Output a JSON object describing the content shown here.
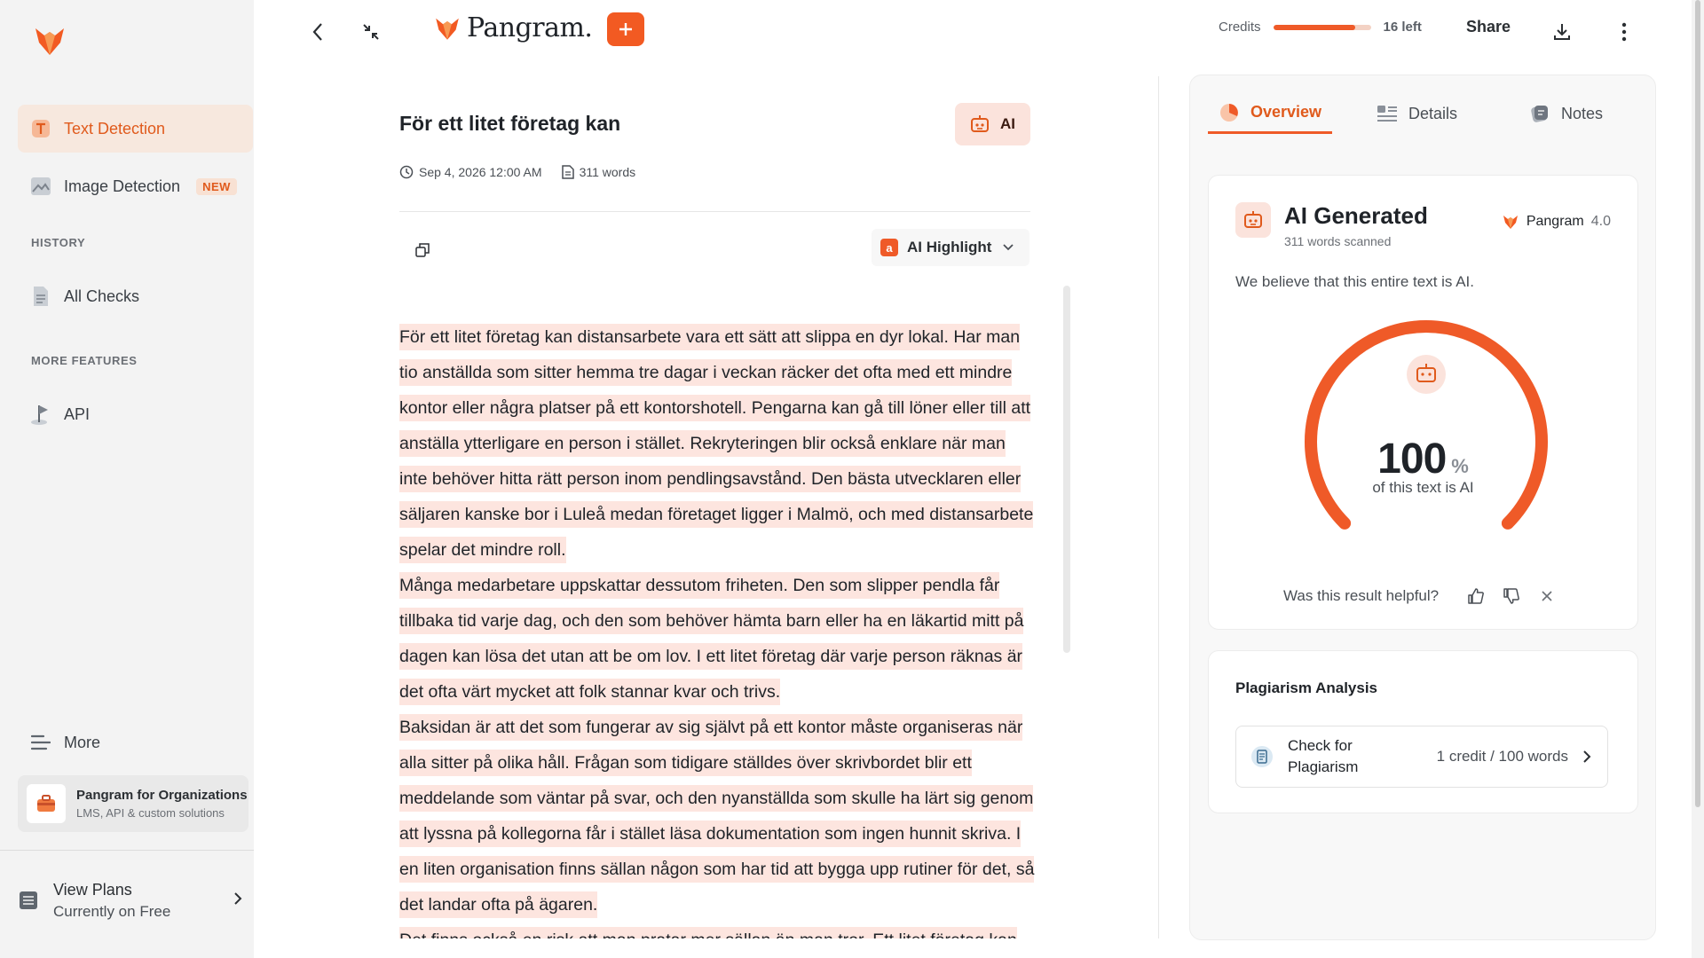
{
  "sidebar": {
    "nav": [
      {
        "label": "Text Detection",
        "icon": "text-icon"
      },
      {
        "label": "Image Detection",
        "icon": "image-icon",
        "badge": "NEW"
      }
    ],
    "history_label": "HISTORY",
    "all_checks": "All Checks",
    "more_features_label": "MORE FEATURES",
    "api": "API",
    "more": "More",
    "org": {
      "title": "Pangram for Organizations",
      "subtitle": "LMS, API & custom solutions"
    },
    "plans": {
      "title": "View Plans",
      "subtitle": "Currently on Free"
    }
  },
  "topbar": {
    "brand": "Pangram.",
    "credits_label": "Credits",
    "credits_left": "16 left",
    "credits_fraction": 0.84,
    "share": "Share"
  },
  "document": {
    "title": "För ett litet företag kan",
    "verdict_badge": "AI",
    "date": "Sep 4, 2026 12:00 AM",
    "words": "311 words",
    "highlight_mode": "AI Highlight",
    "paragraphs": [
      "För ett litet företag kan distansarbete vara ett sätt att slippa en dyr lokal. Har man tio anställda som sitter hemma tre dagar i veckan räcker det ofta med ett mindre kontor eller några platser på ett kontorshotell. Pengarna kan gå till löner eller till att anställa ytterligare en person i stället. Rekryteringen blir också enklare när man inte behöver hitta rätt person inom pendlingsavstånd. Den bästa utvecklaren eller säljaren kanske bor i Luleå medan företaget ligger i Malmö, och med distansarbete spelar det mindre roll.",
      "Många medarbetare uppskattar dessutom friheten. Den som slipper pendla får tillbaka tid varje dag, och den som behöver hämta barn eller ha en läkartid mitt på dagen kan lösa det utan att be om lov. I ett litet företag där varje person räknas är det ofta värt mycket att folk stannar kvar och trivs.",
      "Baksidan är att det som fungerar av sig självt på ett kontor måste organiseras när alla sitter på olika håll. Frågan som tidigare ställdes över skrivbordet blir ett meddelande som väntar på svar, och den nyanställda som skulle ha lärt sig genom att lyssna på kollegorna får i stället läsa dokumentation som ingen hunnit skriva. I en liten organisation finns sällan någon som har tid att bygga upp rutiner för det, så det landar ofta på ägaren.",
      "Det finns också en risk att man pratar mer sällan än man tror. Ett litet företag kan"
    ]
  },
  "panel": {
    "tabs": [
      {
        "label": "Overview",
        "icon": "overview-icon"
      },
      {
        "label": "Details",
        "icon": "details-icon"
      },
      {
        "label": "Notes",
        "icon": "notes-icon"
      }
    ],
    "result": {
      "title": "AI Generated",
      "scanned": "311 words scanned",
      "model_name": "Pangram",
      "model_version": "4.0",
      "belief": "We believe that this entire text is AI.",
      "percent": "100",
      "percent_sign": "%",
      "percent_value": 100,
      "percent_label": "of this text is AI",
      "helpful": "Was this result helpful?"
    },
    "plagiarism": {
      "title": "Plagiarism Analysis",
      "action": "Check for Plagiarism",
      "cost": "1 credit / 100 words"
    }
  },
  "colors": {
    "accent": "#ef5a28",
    "highlight": "#fde5df",
    "badge_bg": "#fbe3dc"
  }
}
